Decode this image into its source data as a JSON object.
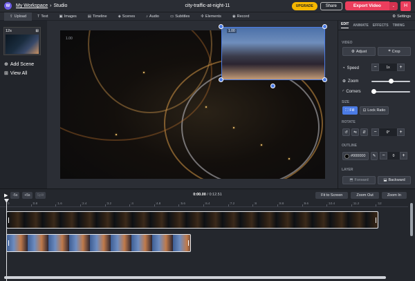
{
  "header": {
    "logo_text": "W",
    "workspace_link": "My Workspace",
    "separator": "›",
    "section": "Studio",
    "project_title": "city-traffic-at-night-11",
    "upgrade_label": "UPGRADE",
    "share_label": "Share",
    "export_label": "Export Video",
    "export_dropdown": "⌄",
    "avatar_initial": "H"
  },
  "toolbar": {
    "items": [
      {
        "icon": "⇪",
        "label": "Upload"
      },
      {
        "icon": "T",
        "label": "Text"
      },
      {
        "icon": "▣",
        "label": "Images"
      },
      {
        "icon": "▤",
        "label": "Timeline"
      },
      {
        "icon": "◈",
        "label": "Scenes"
      },
      {
        "icon": "♪",
        "label": "Audio"
      },
      {
        "icon": "▭",
        "label": "Subtitles"
      },
      {
        "icon": "✣",
        "label": "Elements"
      },
      {
        "icon": "◉",
        "label": "Record"
      }
    ],
    "settings_icon": "⚙",
    "settings_label": "Settings"
  },
  "left_panel": {
    "scene_duration": "12s",
    "add_scene": "Add Scene",
    "view_all": "View All",
    "add_icon": "⊕",
    "grid_icon": "⊞"
  },
  "canvas": {
    "main_layer_label": "1.00",
    "inset_layer_label": "1.00"
  },
  "right_panel": {
    "tabs": [
      "EDIT",
      "ANIMATE",
      "EFFECTS",
      "TIMING"
    ],
    "video_section": "VIDEO",
    "adjust_label": "Adjust",
    "crop_label": "Crop",
    "speed_label": "Speed",
    "speed_value": "1x",
    "zoom_label": "Zoom",
    "zoom_level": 0.5,
    "corners_label": "Corners",
    "corners_level": 0.0,
    "size_section": "SIZE",
    "fill_label": "Fill",
    "lock_ratio_label": "Lock Ratio",
    "rotate_section": "ROTATE",
    "rotate_value": "0°",
    "outline_section": "OUTLINE",
    "outline_color": "#000000",
    "outline_value": "0",
    "layer_section": "LAYER",
    "forward_label": "Forward",
    "backward_label": "Backward"
  },
  "timeline": {
    "back5": "-5s",
    "fwd5": "+5s",
    "split": "Split",
    "current_time": "0:00.00",
    "total_time": "0:12.51",
    "fit_label": "Fit to Screen",
    "zoom_out_label": "Zoom Out",
    "zoom_in_label": "Zoom In",
    "ticks": [
      "0",
      ":0.8",
      ":1.6",
      ":2.4",
      ":3.2",
      ":4",
      ":4.8",
      ":5.6",
      ":6.4",
      ":7.2",
      ":8",
      ":8.8",
      ":9.6",
      ":10.4",
      ":11.2",
      ":12"
    ]
  },
  "colors": {
    "accent": "#4b7be5",
    "export": "#ec3e5d",
    "upgrade": "#f5b700"
  }
}
